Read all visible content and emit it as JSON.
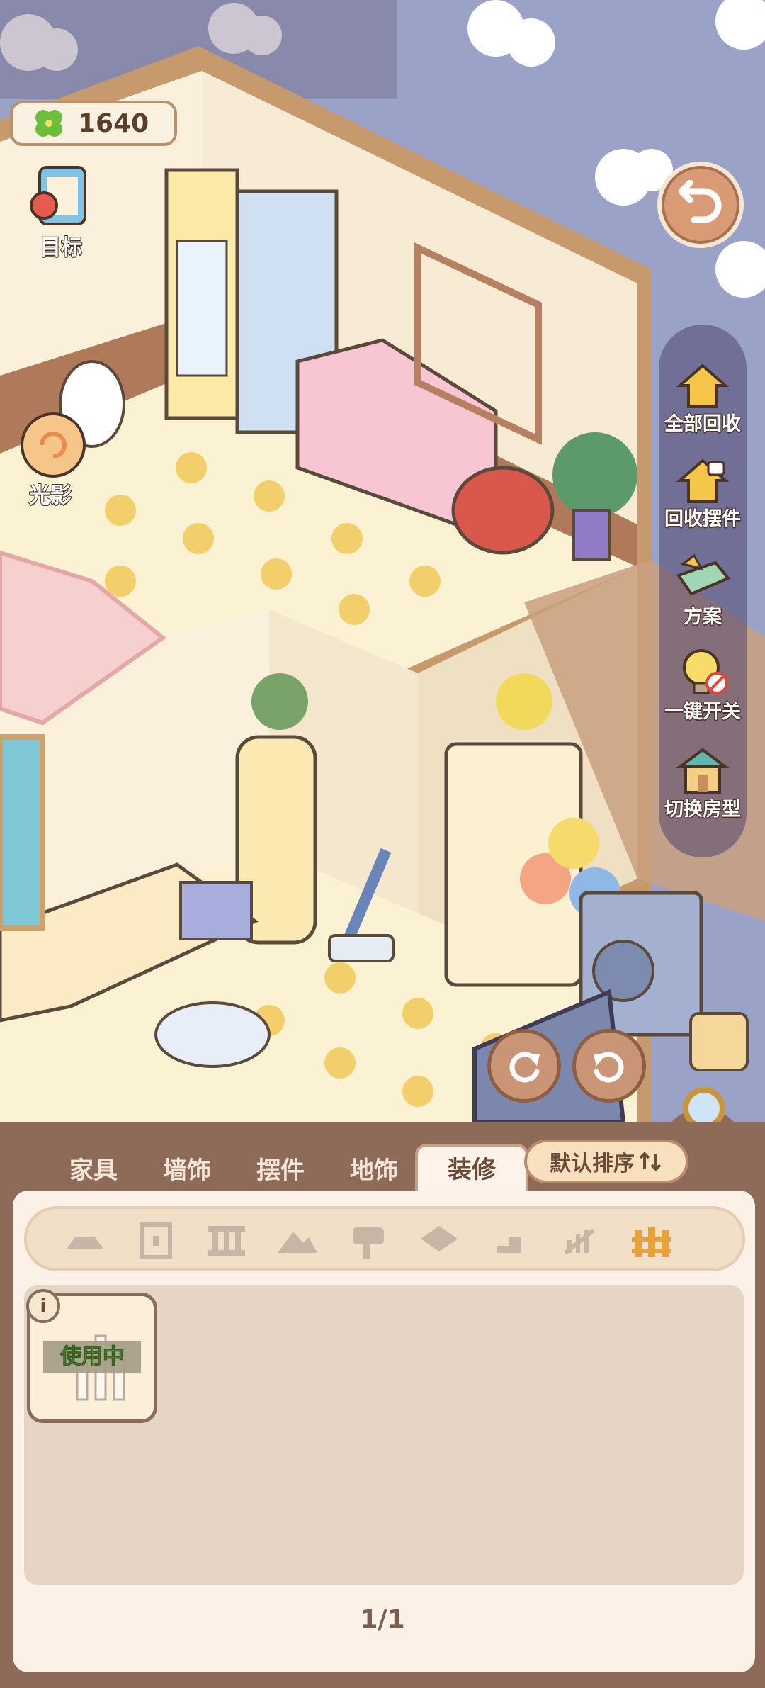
{
  "hud": {
    "clover_count": "1640",
    "goal_label": "目标",
    "light_label": "光影"
  },
  "side_menu": [
    {
      "id": "recycle-all",
      "label": "全部回收"
    },
    {
      "id": "recycle-ornaments",
      "label": "回收摆件"
    },
    {
      "id": "plans",
      "label": "方案"
    },
    {
      "id": "one-key-switch",
      "label": "一键开关"
    },
    {
      "id": "switch-house",
      "label": "切换房型"
    }
  ],
  "tabs": [
    {
      "label": "家具"
    },
    {
      "label": "墙饰"
    },
    {
      "label": "摆件"
    },
    {
      "label": "地饰"
    },
    {
      "label": "装修",
      "active": true
    }
  ],
  "sort": {
    "label": "默认排序"
  },
  "categories": [
    "floor",
    "door",
    "fence",
    "roof",
    "mailbox",
    "tile",
    "step",
    "railing",
    "picket-fence"
  ],
  "selected_category": "picket-fence",
  "items": [
    {
      "status": "使用中",
      "info": "i"
    }
  ],
  "pager": "1/1",
  "colors": {
    "panel": "#8e6b58",
    "inner": "#fbf1e6",
    "sky": "#9aa2c8",
    "accent_green": "#8fe05a"
  }
}
